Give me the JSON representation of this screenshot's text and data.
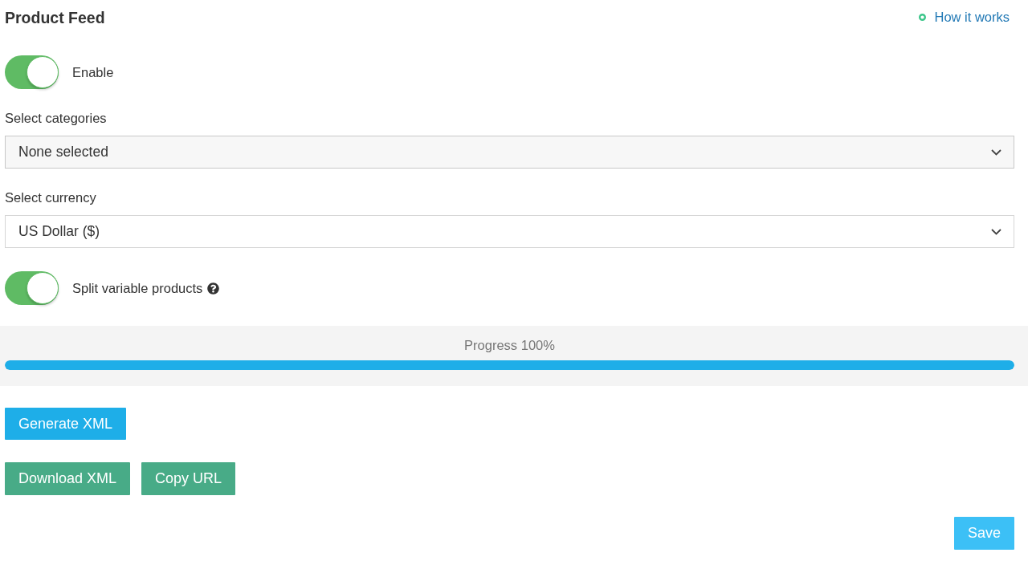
{
  "header": {
    "title": "Product Feed",
    "help_link": "How it works"
  },
  "settings": [
    {
      "kind": "toggle",
      "label": "Enable",
      "on": true,
      "help": false
    },
    {
      "kind": "multiselect",
      "label": "Select categories",
      "value": "None selected"
    },
    {
      "kind": "select",
      "label": "Select currency",
      "value": "US Dollar ($)"
    },
    {
      "kind": "toggle",
      "label": "Split variable products",
      "on": true,
      "help": true
    }
  ],
  "progress": {
    "label": "Progress 100%",
    "level": 1
  },
  "action_rows": [
    [
      {
        "label": "Generate XML",
        "kind": "primary"
      }
    ],
    [
      {
        "label": "Download XML",
        "kind": "success"
      },
      {
        "label": "Copy URL",
        "kind": "success"
      }
    ]
  ],
  "footer": {
    "save_button": "Save"
  }
}
